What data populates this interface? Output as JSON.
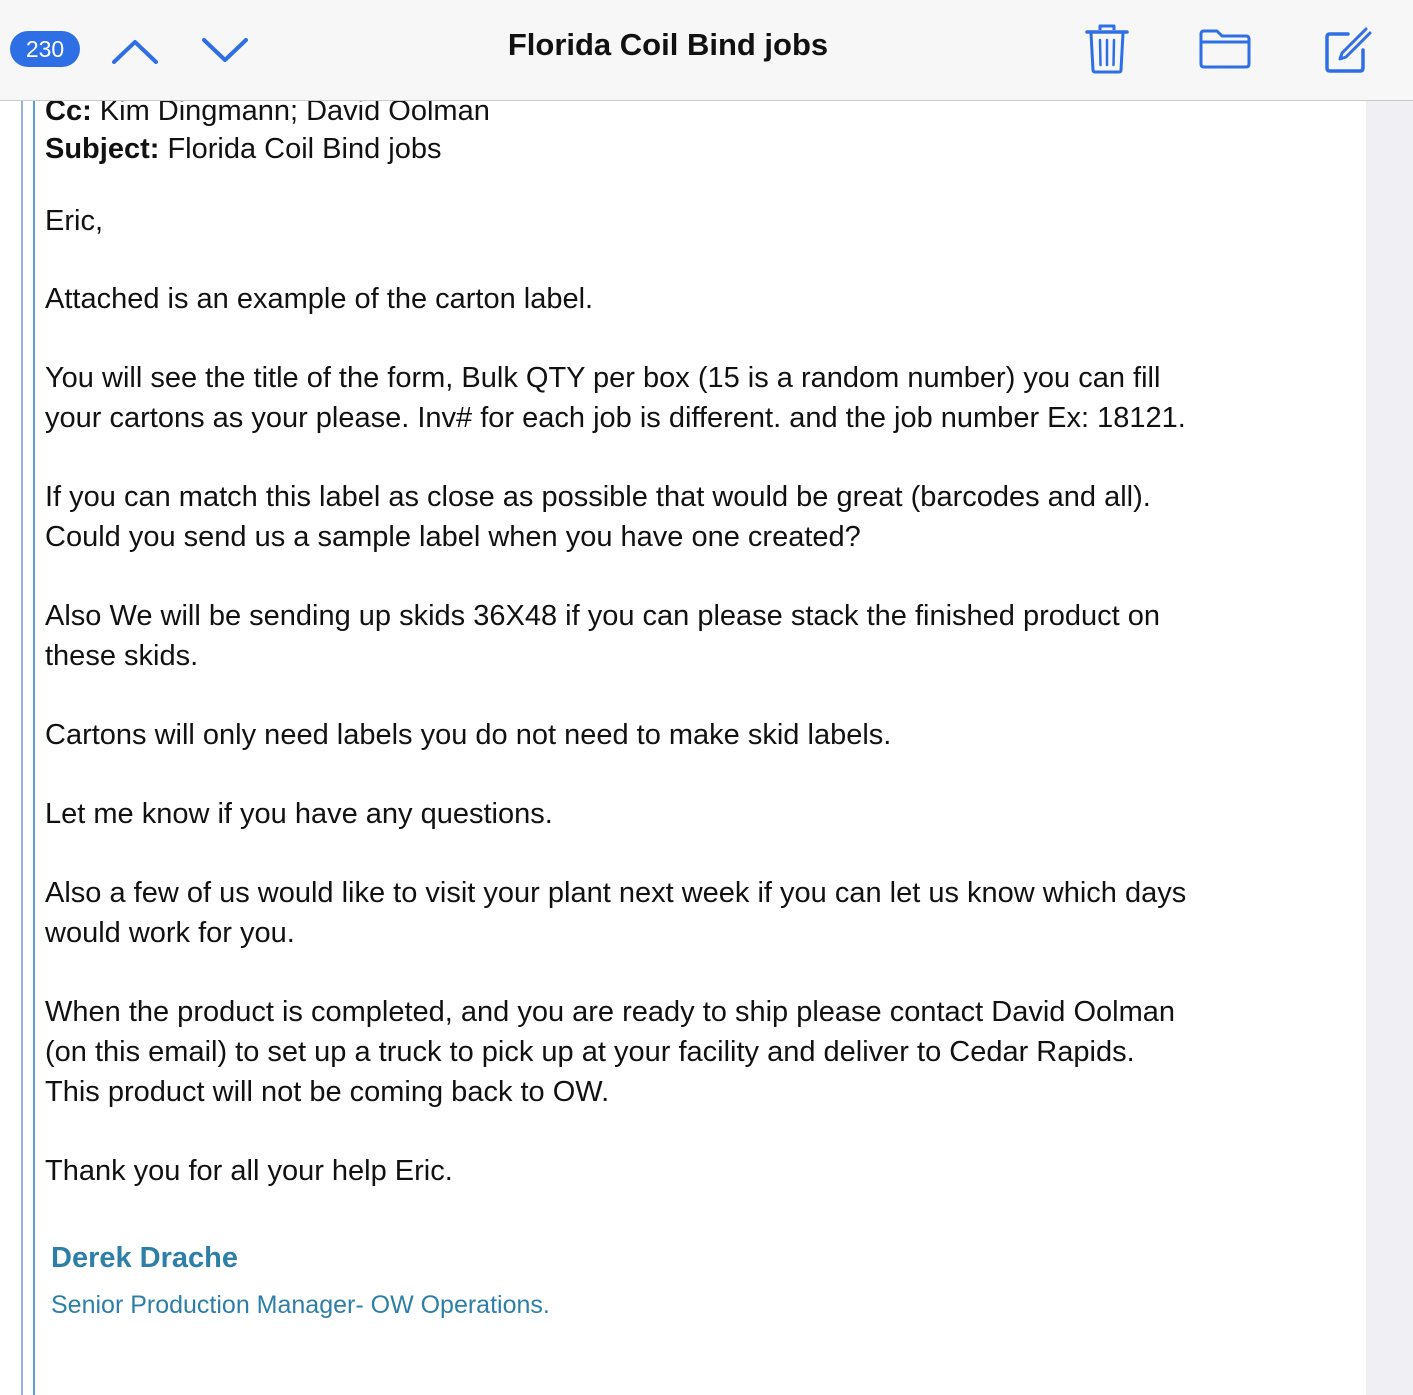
{
  "toolbar": {
    "unread_count": "230",
    "title": "Florida Coil Bind jobs",
    "accent_color": "#2f6fe6",
    "icons": [
      "chevron-up-icon",
      "chevron-down-icon",
      "trash-icon",
      "folder-icon",
      "compose-icon"
    ]
  },
  "email": {
    "cc_label": "Cc:",
    "cc_value": "Kim Dingmann; David Oolman",
    "subject_label": "Subject:",
    "subject_value": "Florida Coil Bind jobs",
    "greeting": "Eric,",
    "paragraphs": [
      "Attached is an example of the carton label.",
      "You will see the title of the form, Bulk QTY per box (15 is a random number) you can fill\nyour cartons as your please. Inv# for each job is different. and the job number Ex: 18121.",
      "If you can match this label as close as possible that would be great (barcodes and all).\nCould you send us a sample label when you have one created?",
      "Also We will be sending up skids 36X48 if you can please stack the finished product on\nthese skids.",
      "Cartons will only need labels you do not need to make skid labels.",
      "Let me know if you have any questions.",
      "Also a few of us would like to visit your plant next week if you can let us know which days\nwould work for you.",
      "When the product is completed, and you are ready to ship please contact David Oolman\n(on this email) to set up a truck to pick up at your facility and deliver to Cedar Rapids.\nThis product will not be coming back to OW.",
      "Thank you for all your help Eric."
    ],
    "signature_name": "Derek Drache",
    "signature_title": "Senior Production Manager- OW Operations.",
    "signature_color": "#2d7fa8"
  }
}
